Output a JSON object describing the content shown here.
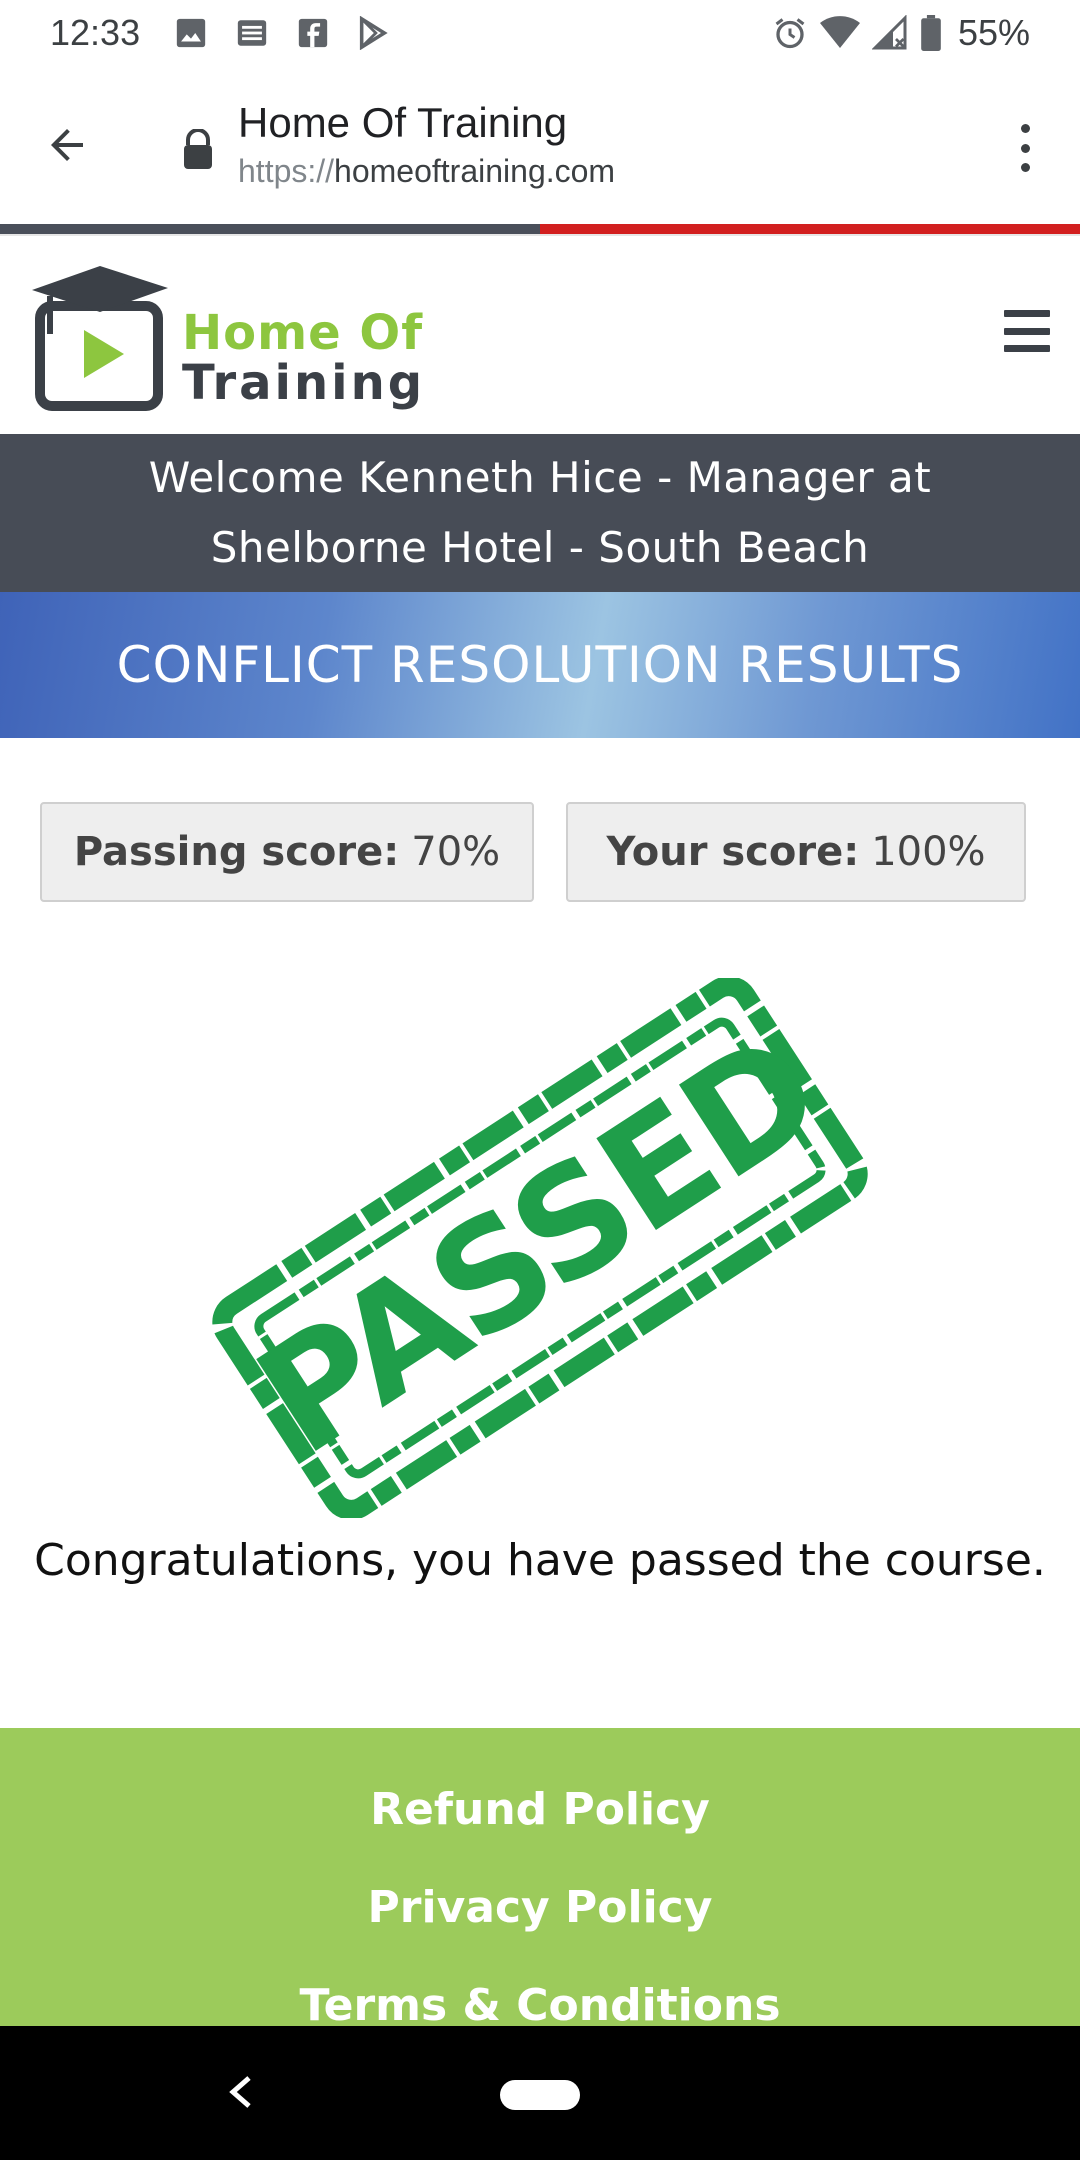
{
  "status_bar": {
    "time": "12:33",
    "left_icons": [
      "image-icon",
      "news-icon",
      "facebook-icon",
      "play-store-icon"
    ],
    "right_icons": [
      "alarm-icon",
      "wifi-icon",
      "signal-icon",
      "battery-icon"
    ],
    "battery_percent": "55%"
  },
  "browser": {
    "tab_title": "Home Of Training",
    "url_scheme": "https://",
    "url_host": "homeoftraining.com",
    "page_load_progress": 0.5
  },
  "site": {
    "logo_line1": "Home Of",
    "logo_line2": "Training",
    "welcome_text": "Welcome Kenneth Hice - Manager at Shelborne Hotel - South Beach",
    "results_title": "CONFLICT RESOLUTION RESULTS",
    "passing_score_label": "Passing score:",
    "passing_score_value": "70%",
    "your_score_label": "Your score:",
    "your_score_value": "100%",
    "stamp_text": "PASSED",
    "congrats_text": "Congratulations, you have passed the course."
  },
  "footer": {
    "links": [
      "Refund Policy",
      "Privacy Policy",
      "Terms & Conditions"
    ]
  },
  "colors": {
    "brand_green": "#8dc63f",
    "brand_dark": "#3b4047",
    "welcome_bg": "#474c56",
    "stamp_green": "#1f9e4a",
    "footer_bg": "#9ccb5b",
    "progress_red": "#d21f1f"
  }
}
